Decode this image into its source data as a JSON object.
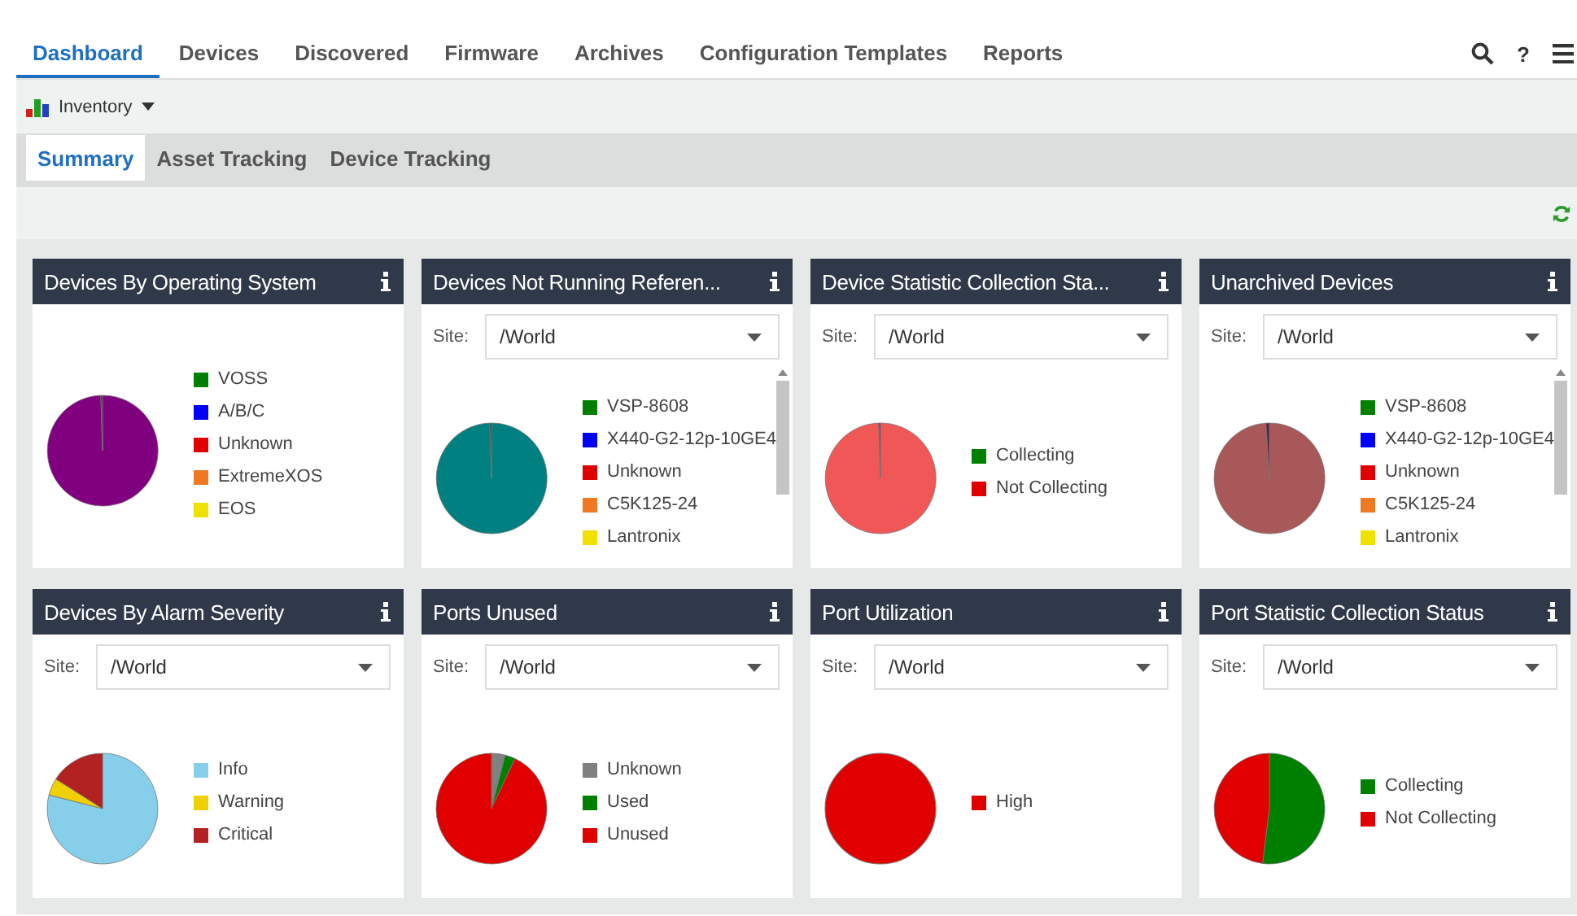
{
  "nav": {
    "tabs": [
      {
        "label": "Dashboard",
        "selected": true
      },
      {
        "label": "Devices",
        "selected": false
      },
      {
        "label": "Discovered",
        "selected": false
      },
      {
        "label": "Firmware",
        "selected": false
      },
      {
        "label": "Archives",
        "selected": false
      },
      {
        "label": "Configuration Templates",
        "selected": false
      },
      {
        "label": "Reports",
        "selected": false
      }
    ],
    "help": "?"
  },
  "toolbar": {
    "view": "Inventory"
  },
  "subtabs": [
    {
      "label": "Summary",
      "selected": true
    },
    {
      "label": "Asset Tracking",
      "selected": false
    },
    {
      "label": "Device Tracking",
      "selected": false
    }
  ],
  "widgets": [
    {
      "title": "Devices By Operating System",
      "scrollbar": false,
      "legend": [
        {
          "label": "VOSS",
          "color": "#008000"
        },
        {
          "label": "A/B/C",
          "color": "#0000ff"
        },
        {
          "label": "Unknown",
          "color": "#e00000"
        },
        {
          "label": "ExtremeXOS",
          "color": "#f07820"
        },
        {
          "label": "EOS",
          "color": "#f0e000"
        }
      ]
    },
    {
      "title": "Devices Not Running Referen...",
      "site": {
        "label": "Site:",
        "value": "/World"
      },
      "scrollbar": true,
      "legend": [
        {
          "label": "VSP-8608",
          "color": "#008000"
        },
        {
          "label": "X440-G2-12p-10GE4",
          "color": "#0000ff"
        },
        {
          "label": "Unknown",
          "color": "#e00000"
        },
        {
          "label": "C5K125-24",
          "color": "#f07820"
        },
        {
          "label": "Lantronix",
          "color": "#f0e000"
        }
      ]
    },
    {
      "title": "Device Statistic Collection Sta...",
      "site": {
        "label": "Site:",
        "value": "/World"
      },
      "scrollbar": false,
      "legend": [
        {
          "label": "Collecting",
          "color": "#008000"
        },
        {
          "label": "Not Collecting",
          "color": "#e00000"
        }
      ]
    },
    {
      "title": "Unarchived Devices",
      "site": {
        "label": "Site:",
        "value": "/World"
      },
      "scrollbar": true,
      "legend": [
        {
          "label": "VSP-8608",
          "color": "#008000"
        },
        {
          "label": "X440-G2-12p-10GE4",
          "color": "#0000ff"
        },
        {
          "label": "Unknown",
          "color": "#e00000"
        },
        {
          "label": "C5K125-24",
          "color": "#f07820"
        },
        {
          "label": "Lantronix",
          "color": "#f0e000"
        }
      ]
    },
    {
      "title": "Devices By Alarm Severity",
      "site": {
        "label": "Site:",
        "value": "/World"
      },
      "scrollbar": false,
      "legend": [
        {
          "label": "Info",
          "color": "#87ceeb"
        },
        {
          "label": "Warning",
          "color": "#f0d000"
        },
        {
          "label": "Critical",
          "color": "#b22222"
        }
      ]
    },
    {
      "title": "Ports Unused",
      "site": {
        "label": "Site:",
        "value": "/World"
      },
      "scrollbar": false,
      "legend": [
        {
          "label": "Unknown",
          "color": "#808080"
        },
        {
          "label": "Used",
          "color": "#008000"
        },
        {
          "label": "Unused",
          "color": "#e00000"
        }
      ]
    },
    {
      "title": "Port Utilization",
      "site": {
        "label": "Site:",
        "value": "/World"
      },
      "scrollbar": false,
      "legend": [
        {
          "label": "High",
          "color": "#e00000"
        }
      ]
    },
    {
      "title": "Port Statistic Collection Status",
      "site": {
        "label": "Site:",
        "value": "/World"
      },
      "scrollbar": false,
      "legend": [
        {
          "label": "Collecting",
          "color": "#008000"
        },
        {
          "label": "Not Collecting",
          "color": "#e00000"
        }
      ]
    }
  ]
}
